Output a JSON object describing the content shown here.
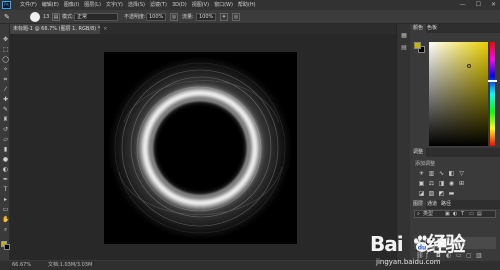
{
  "menubar": {
    "app_logo": "Ps",
    "menus": [
      "文件(F)",
      "编辑(E)",
      "图像(I)",
      "图层(L)",
      "文字(Y)",
      "选择(S)",
      "滤镜(T)",
      "3D(D)",
      "视图(V)",
      "窗口(W)",
      "帮助(H)"
    ],
    "window_controls": [
      "—",
      "☐",
      "✕"
    ]
  },
  "options": {
    "brush_size": "13",
    "mode_label": "模式:",
    "mode_value": "正常",
    "opacity_label": "不透明度:",
    "opacity_value": "100%",
    "flow_label": "流量:",
    "flow_value": "100%"
  },
  "document": {
    "tab_title": "未标题-1 @ 66.7% (图层 1, RGB/8) *",
    "close": "×"
  },
  "status": {
    "zoom": "66.67%",
    "doc_size": "文档:1.03M/3.03M"
  },
  "panels": {
    "color_tabs": [
      "颜色",
      "色板"
    ],
    "adjust_tab": "调整",
    "adjust_subtitle": "添加调整",
    "layer_tabs": [
      "图层",
      "通道",
      "路径"
    ],
    "filter_label": "类型",
    "layer_name": "图层 1"
  },
  "colors": {
    "foreground": "#c8b400",
    "background": "#000000",
    "accent": "#31a8ff"
  },
  "watermark": {
    "logo_text": "Bai",
    "logo_tail": "经验",
    "url": "jingyan.baidu.com"
  }
}
